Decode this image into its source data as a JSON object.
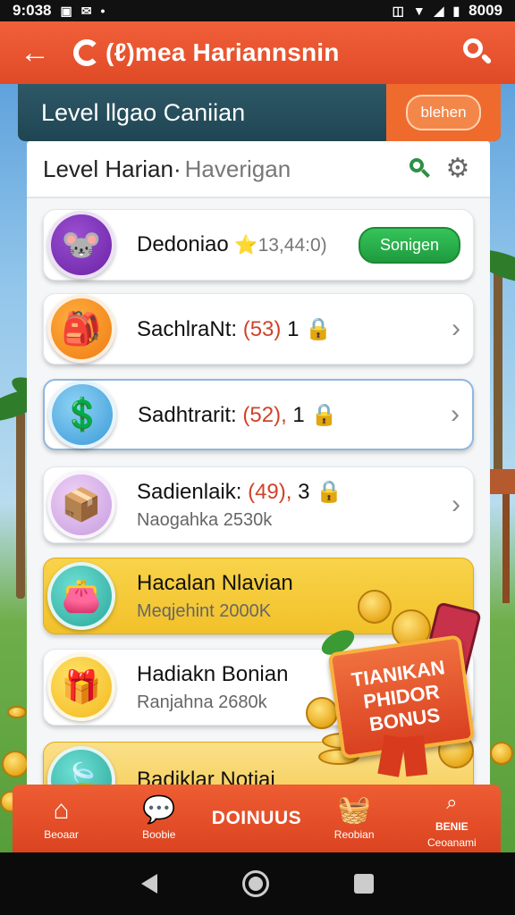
{
  "status_bar": {
    "time": "9:038",
    "battery_text": "8009"
  },
  "app_bar": {
    "back_glyph": "←",
    "title": "(ℓ)mea Hariannsnin"
  },
  "banner": {
    "title": "Level llgao Caniian",
    "button_label": "blehen"
  },
  "panel": {
    "title": "Level Harian·",
    "subtitle": "Haverigan"
  },
  "cards": [
    {
      "title": "Dedoniao",
      "meta": "⭐13,44:0)",
      "action_label": "Sonigen"
    },
    {
      "title": "SachlraNt:",
      "count": "(53)",
      "level": "1"
    },
    {
      "title": "Sadhtrarit:",
      "count": "(52),",
      "level": "1"
    },
    {
      "title": "Sadienlaik:",
      "count": "(49),",
      "level": "3",
      "subtitle": "Naogahka 2530k"
    },
    {
      "title": "Hacalan Nlavian",
      "subtitle": "Meqjehint 2000K"
    },
    {
      "title": "Hadiakn Bonian",
      "subtitle": "Ranjahna 2680k"
    },
    {
      "title": "Badiklar Notiai"
    }
  ],
  "bonus_badge": {
    "line1": "TIANIKAN",
    "line2": "PHIDOR",
    "line3": "BONUS"
  },
  "bottom_nav": {
    "items": [
      {
        "label": "Beoaar",
        "icon": "home-icon"
      },
      {
        "label": "Boobie",
        "icon": "chat-bubble-icon"
      },
      {
        "label": "DOINUUS",
        "icon": "bonus-text"
      },
      {
        "label": "Reobian",
        "icon": "basket-icon"
      },
      {
        "label": "Ceoanami",
        "icon": "search-icon",
        "top_text": "BENIE"
      }
    ]
  },
  "colors": {
    "accent": "#e04a26",
    "banner": "#1f4553",
    "gold": "#f2c12a",
    "green": "#1f9b3e"
  }
}
